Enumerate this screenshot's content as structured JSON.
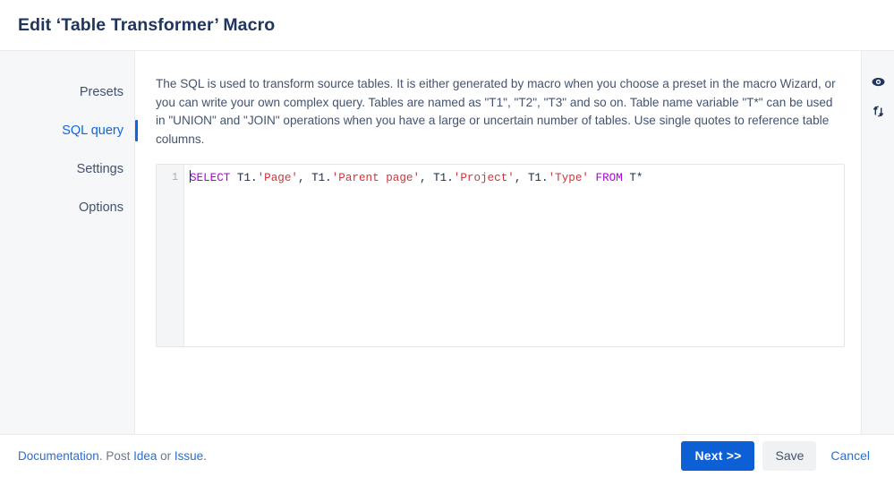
{
  "header": {
    "title": "Edit ‘Table Transformer’ Macro"
  },
  "sidebar": {
    "items": [
      {
        "label": "Presets",
        "name": "presets",
        "active": false
      },
      {
        "label": "SQL query",
        "name": "sql-query",
        "active": true
      },
      {
        "label": "Settings",
        "name": "settings",
        "active": false
      },
      {
        "label": "Options",
        "name": "options",
        "active": false
      }
    ]
  },
  "main": {
    "description": "The SQL is used to transform source tables. It is either generated by macro when you choose a preset in the macro Wizard, or you can write your own complex query. Tables are named as \"T1\", \"T2\", \"T3\" and so on. Table name variable \"T*\" can be used in \"UNION\" and \"JOIN\" operations when you have a large or uncertain number of tables. Use single quotes to reference table columns.",
    "editor": {
      "line_numbers": [
        "1"
      ],
      "sql_text": "SELECT T1.'Page', T1.'Parent page', T1.'Project', T1.'Type' FROM T*",
      "tokens": [
        {
          "text": "SELECT",
          "type": "keyword"
        },
        {
          "text": " T1.",
          "type": "plain"
        },
        {
          "text": "'Page'",
          "type": "string"
        },
        {
          "text": ", T1.",
          "type": "plain"
        },
        {
          "text": "'Parent page'",
          "type": "string"
        },
        {
          "text": ", T1.",
          "type": "plain"
        },
        {
          "text": "'Project'",
          "type": "string"
        },
        {
          "text": ", T1.",
          "type": "plain"
        },
        {
          "text": "'Type'",
          "type": "string"
        },
        {
          "text": " ",
          "type": "plain"
        },
        {
          "text": "FROM",
          "type": "keyword"
        },
        {
          "text": " T*",
          "type": "plain"
        }
      ]
    }
  },
  "rail": {
    "preview_icon": "eye-icon",
    "refresh_icon": "refresh-icon"
  },
  "footer": {
    "documentation_label": "Documentation",
    "after_documentation": ". Post ",
    "idea_label": "Idea",
    "between": " or ",
    "issue_label": "Issue",
    "trailing": ".",
    "next_label": "Next >>",
    "save_label": "Save",
    "cancel_label": "Cancel"
  },
  "colors": {
    "accent": "#0c66e4",
    "primary_button": "#0c5fd4",
    "link": "#2a6fd4",
    "title": "#21365c",
    "body_text": "#44546f",
    "sidebar_bg": "#f6f7f9",
    "keyword": "#af00db",
    "string": "#d13438"
  }
}
